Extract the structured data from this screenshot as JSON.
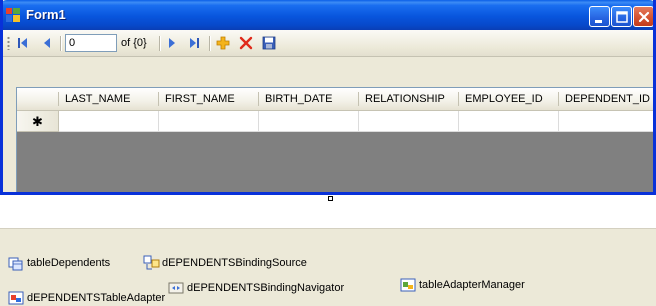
{
  "window": {
    "title": "Form1"
  },
  "navigator": {
    "position_value": "0",
    "count_label": "of {0}",
    "buttons": [
      "move-first",
      "move-previous",
      "move-next",
      "move-last",
      "add-new",
      "delete",
      "save"
    ]
  },
  "grid": {
    "columns": [
      "LAST_NAME",
      "FIRST_NAME",
      "BIRTH_DATE",
      "RELATIONSHIP",
      "EMPLOYEE_ID",
      "DEPENDENT_ID"
    ],
    "new_row_marker": "✱"
  },
  "tray": {
    "components": [
      {
        "label": "tableDependents",
        "icon": "dataset-icon"
      },
      {
        "label": "dEPENDENTSBindingSource",
        "icon": "binding-source-icon"
      },
      {
        "label": "dEPENDENTSBindingNavigator",
        "icon": "binding-navigator-icon"
      },
      {
        "label": "tableAdapterManager",
        "icon": "table-adapter-manager-icon"
      },
      {
        "label": "dEPENDENTSTableAdapter",
        "icon": "table-adapter-icon"
      }
    ]
  },
  "colors": {
    "titlebar": "#0855dd",
    "grid_background": "#808080",
    "tray_background": "#ece9d8"
  }
}
